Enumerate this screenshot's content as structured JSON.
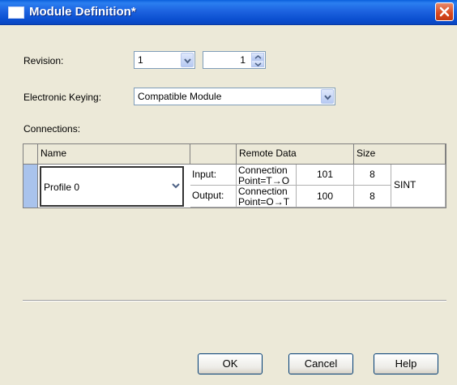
{
  "window": {
    "title": "Module Definition*"
  },
  "revision": {
    "label": "Revision:",
    "major": "1",
    "minor": "1"
  },
  "keying": {
    "label": "Electronic Keying:",
    "value": "Compatible Module"
  },
  "connections": {
    "label": "Connections:",
    "headers": {
      "name": "Name",
      "blank": "",
      "remote": "Remote Data",
      "size": "Size"
    },
    "row": {
      "name": "Profile 0",
      "input_label": "Input:",
      "output_label": "Output:",
      "input_remote": "Connection Point=T→O",
      "output_remote": "Connection Point=O→T",
      "input_point": "101",
      "output_point": "100",
      "input_size": "8",
      "output_size": "8",
      "type": "SINT"
    }
  },
  "buttons": {
    "ok": "OK",
    "cancel": "Cancel",
    "help": "Help"
  },
  "icons": {
    "close": "close-icon",
    "window": "window-icon",
    "dropdown": "chevron-down-icon",
    "spin": "spinner-icon"
  }
}
